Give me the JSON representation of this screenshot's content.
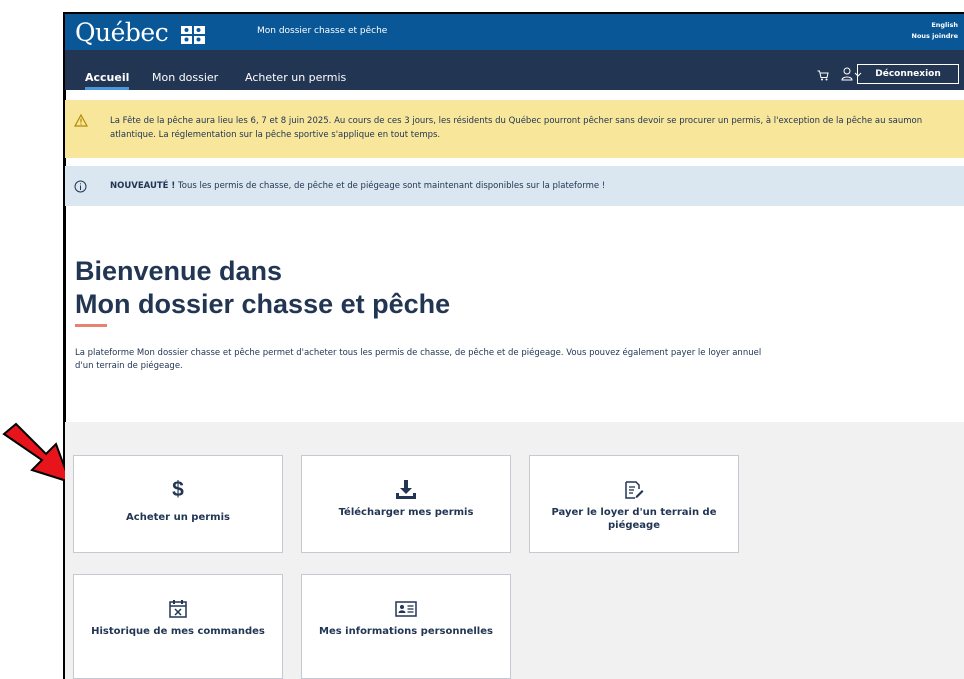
{
  "header": {
    "logo_text": "Québec",
    "site_title": "Mon dossier chasse et pêche",
    "language_link": "English",
    "contact_link": "Nous joindre"
  },
  "nav": {
    "items": [
      {
        "label": "Accueil",
        "active": true
      },
      {
        "label": "Mon dossier",
        "active": false
      },
      {
        "label": "Acheter un permis",
        "active": false
      }
    ],
    "logout_label": "Déconnexion"
  },
  "alerts": {
    "warning_text": "La Fête de la pêche aura lieu les 6, 7 et 8 juin 2025. Au cours de ces 3 jours, les résidents du Québec pourront pêcher sans devoir se procurer un permis, à l'exception de la pêche au saumon atlantique. La réglementation sur la pêche sportive s'applique en tout temps.",
    "info_label": "NOUVEAUTÉ !",
    "info_text": " Tous les permis de chasse, de pêche et de piégeage sont maintenant disponibles sur la plateforme !"
  },
  "main": {
    "title_line1": "Bienvenue dans",
    "title_line2": "Mon dossier chasse et pêche",
    "intro": "La plateforme Mon dossier chasse et pêche permet d'acheter tous les permis de chasse, de pêche et de piégeage. Vous pouvez également payer le loyer annuel d'un terrain de piégeage."
  },
  "tiles": [
    {
      "label": "Acheter un permis",
      "icon": "dollar-icon"
    },
    {
      "label": "Télécharger mes permis",
      "icon": "download-icon"
    },
    {
      "label": "Payer le loyer d'un terrain de piégeage",
      "icon": "edit-document-icon"
    },
    {
      "label": "Historique de mes commandes",
      "icon": "calendar-icon"
    },
    {
      "label": "Mes informations personnelles",
      "icon": "id-card-icon"
    }
  ],
  "colors": {
    "header_blue": "#095797",
    "nav_dark": "#223654",
    "warning_bg": "#f8e69a",
    "info_bg": "#dae6f0",
    "accent_red": "#e58271",
    "annotation_arrow": "#e8141c"
  }
}
